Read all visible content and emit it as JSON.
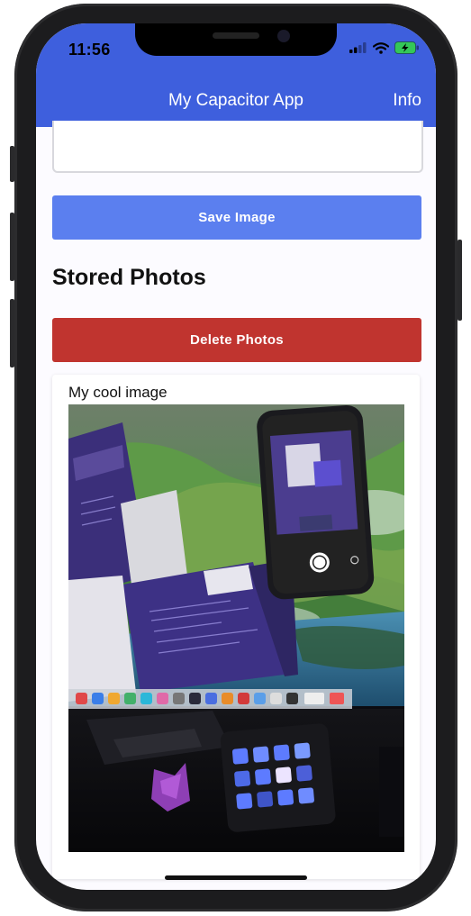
{
  "status_bar": {
    "time": "11:56"
  },
  "header": {
    "title": "My Capacitor App",
    "info_label": "Info"
  },
  "save_button": {
    "label": "Save Image"
  },
  "section": {
    "title": "Stored Photos"
  },
  "delete_button": {
    "label": "Delete Photos"
  },
  "photos": [
    {
      "caption": "My cool image"
    }
  ],
  "colors": {
    "header": "#3e5fdd",
    "save": "#5b7fef",
    "delete": "#c0342f"
  }
}
